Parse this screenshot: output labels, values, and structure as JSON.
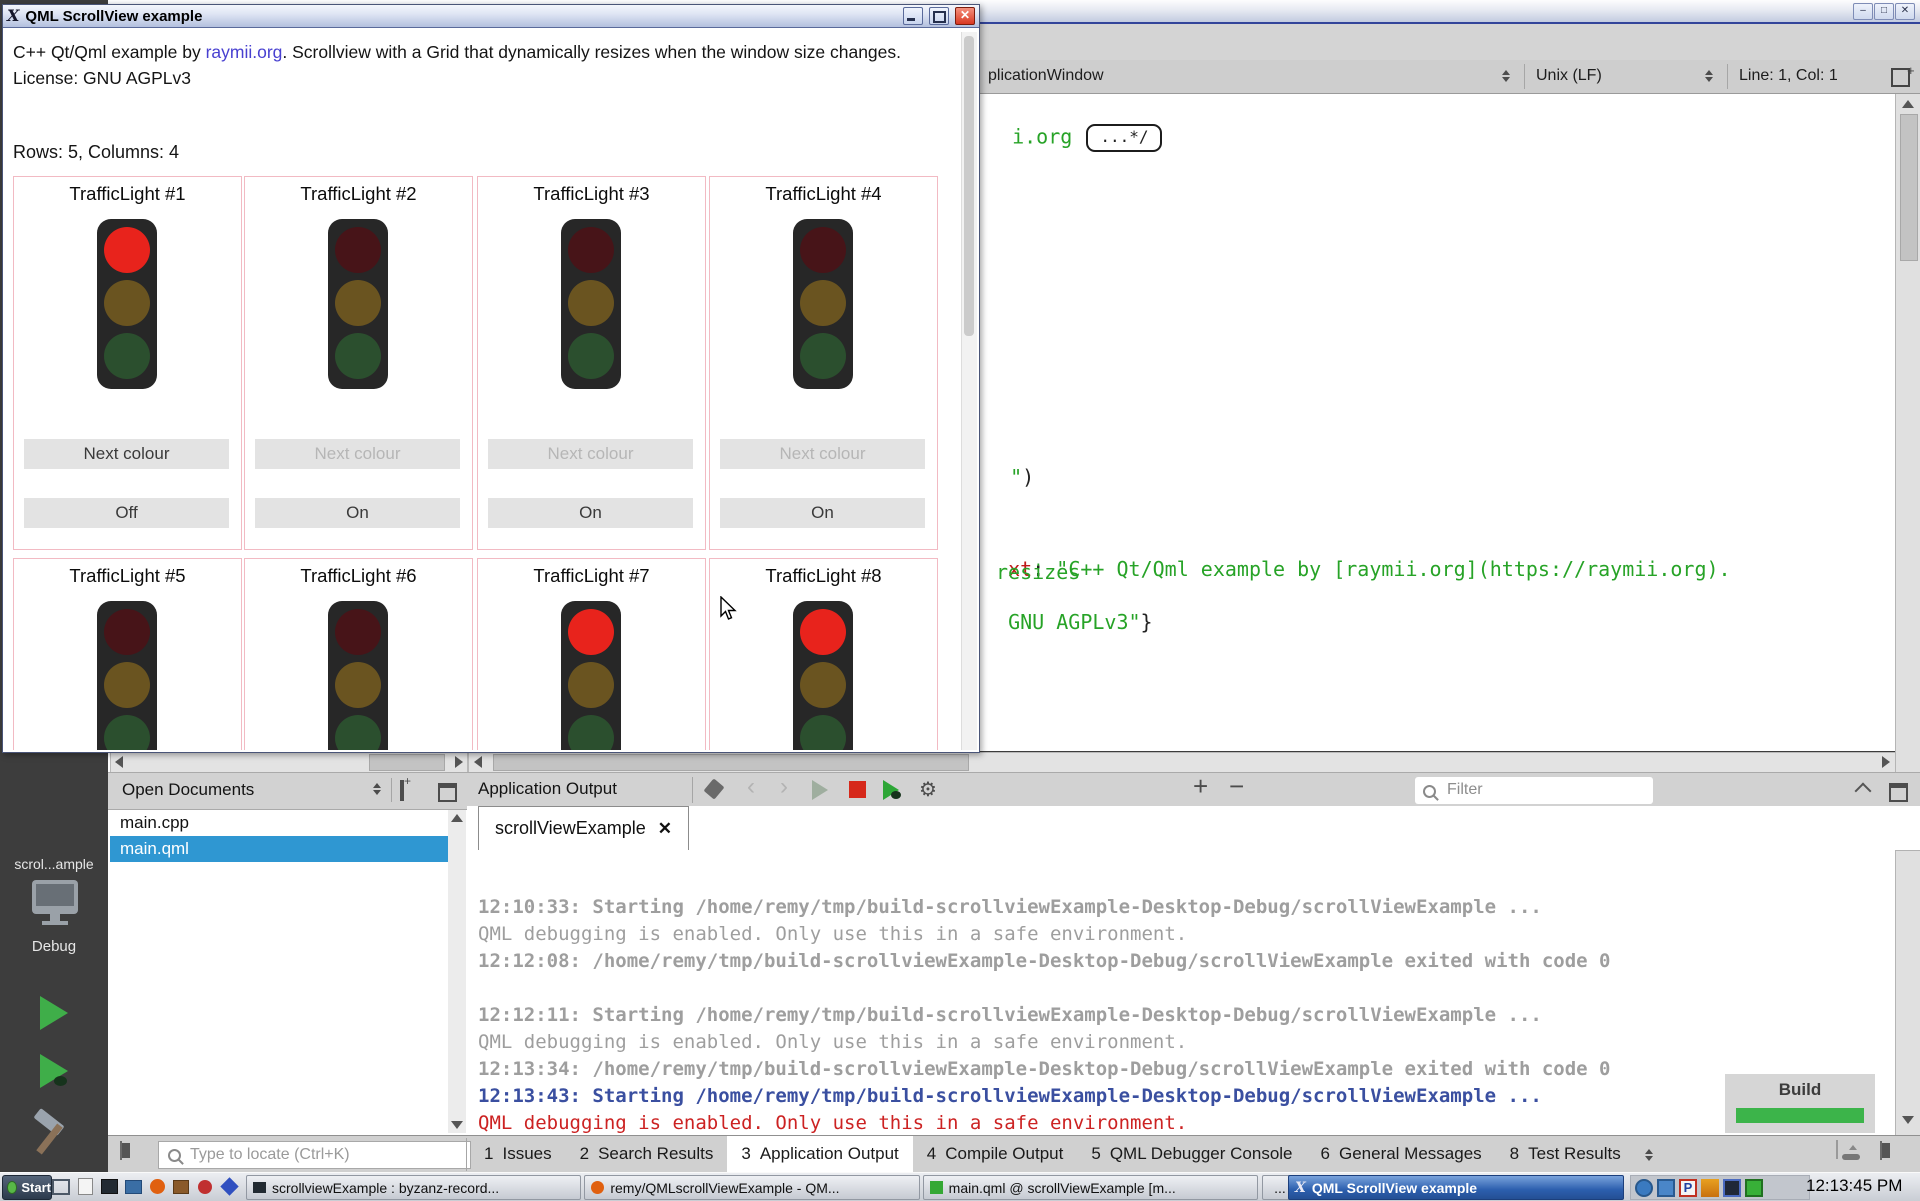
{
  "colors": {
    "selection_blue": "#2f97d2",
    "light_red_on": "#e8231c",
    "light_red_off": "#471418",
    "light_amber_off": "#6a5420",
    "light_green_off": "#2b4f2e",
    "card_border_pink": "#f2bac3",
    "console_gray": "#9e9e9e",
    "console_blue": "#3a4fa0",
    "console_red": "#cc2222",
    "code_green": "#27a327",
    "code_red": "#c01a1a",
    "link_blue": "#4840d0",
    "taskbar_active_blue": "#2c5fae",
    "build_bar_green": "#3cb44a"
  },
  "qml_window": {
    "title": "QML ScrollView example",
    "desc_prefix": "C++ Qt/Qml example by ",
    "desc_link": "raymii.org",
    "desc_suffix": ". Scrollview with a Grid that dynamically resizes when the window size changes.",
    "license": "License: GNU AGPLv3",
    "grid_status": "Rows: 5, Columns: 4",
    "next_label": "Next colour",
    "cards": [
      {
        "title": "TrafficLight #1",
        "light_class": "tlight on",
        "next_class": "cbtn next",
        "power": "Off"
      },
      {
        "title": "TrafficLight #2",
        "light_class": "tlight",
        "next_class": "cbtn next disabled",
        "power": "On"
      },
      {
        "title": "TrafficLight #3",
        "light_class": "tlight",
        "next_class": "cbtn next disabled",
        "power": "On"
      },
      {
        "title": "TrafficLight #4",
        "light_class": "tlight",
        "next_class": "cbtn next disabled",
        "power": "On"
      },
      {
        "title": "TrafficLight #5",
        "light_class": "tlight"
      },
      {
        "title": "TrafficLight #6",
        "light_class": "tlight"
      },
      {
        "title": "TrafficLight #7",
        "light_class": "tlight on"
      },
      {
        "title": "TrafficLight #8",
        "light_class": "tlight on"
      }
    ]
  },
  "editor": {
    "breadcrumb_tail": "plicationWindow",
    "encoding": "Unix (LF)",
    "cursor_pos": "Line: 1, Col: 1",
    "code": {
      "comment_tail": "i.org",
      "fold_marker": "...*/",
      "line_a_string": "\"",
      "line_a_paren": ")",
      "line_b_prop": "xt",
      "line_b_colon": ": ",
      "line_b_string": "\"C++ Qt/Qml example by [raymii.org](https://raymii.org).",
      "line_c_string": "resizes",
      "line_d_string": "GNU AGPLv3\"",
      "line_d_brace": "}"
    }
  },
  "sidebar": {
    "header": "Open Documents",
    "files": [
      "main.cpp",
      "main.qml"
    ],
    "selected_file": "main.qml"
  },
  "output_pane": {
    "header": "Application Output",
    "filter_placeholder": "Filter",
    "tab_label": "scrollViewExample",
    "console": [
      "12:10:33: Starting /home/remy/tmp/build-scrollviewExample-Desktop-Debug/scrollViewExample ...",
      "QML debugging is enabled. Only use this in a safe environment.",
      "12:12:08: /home/remy/tmp/build-scrollviewExample-Desktop-Debug/scrollViewExample exited with code 0",
      "",
      "12:12:11: Starting /home/remy/tmp/build-scrollviewExample-Desktop-Debug/scrollViewExample ...",
      "QML debugging is enabled. Only use this in a safe environment.",
      "12:13:34: /home/remy/tmp/build-scrollviewExample-Desktop-Debug/scrollViewExample exited with code 0",
      "12:13:43: Starting /home/remy/tmp/build-scrollviewExample-Desktop-Debug/scrollViewExample ...",
      "QML debugging is enabled. Only use this in a safe environment."
    ]
  },
  "build_popup": {
    "label": "Build"
  },
  "mode_bar": {
    "project": "scrol...ample",
    "kit": "Debug"
  },
  "bottom_bar": {
    "locator_placeholder": "Type to locate (Ctrl+K)",
    "active_tab_index": 2,
    "tabs": [
      {
        "num": "1",
        "label": "Issues"
      },
      {
        "num": "2",
        "label": "Search Results"
      },
      {
        "num": "3",
        "label": "Application Output"
      },
      {
        "num": "4",
        "label": "Compile Output"
      },
      {
        "num": "5",
        "label": "QML Debugger Console"
      },
      {
        "num": "6",
        "label": "General Messages"
      },
      {
        "num": "8",
        "label": "Test Results"
      }
    ]
  },
  "taskbar": {
    "start_label": "Start",
    "overflow_label": "...",
    "tasks": [
      {
        "label": "scrollviewExample : byzanz-record..."
      },
      {
        "label": "remy/QMLscrollViewExample - QM..."
      },
      {
        "label": "main.qml @ scrollViewExample [m..."
      },
      {
        "label": "QML ScrollView example"
      }
    ],
    "clock": "12:13:45 PM"
  }
}
